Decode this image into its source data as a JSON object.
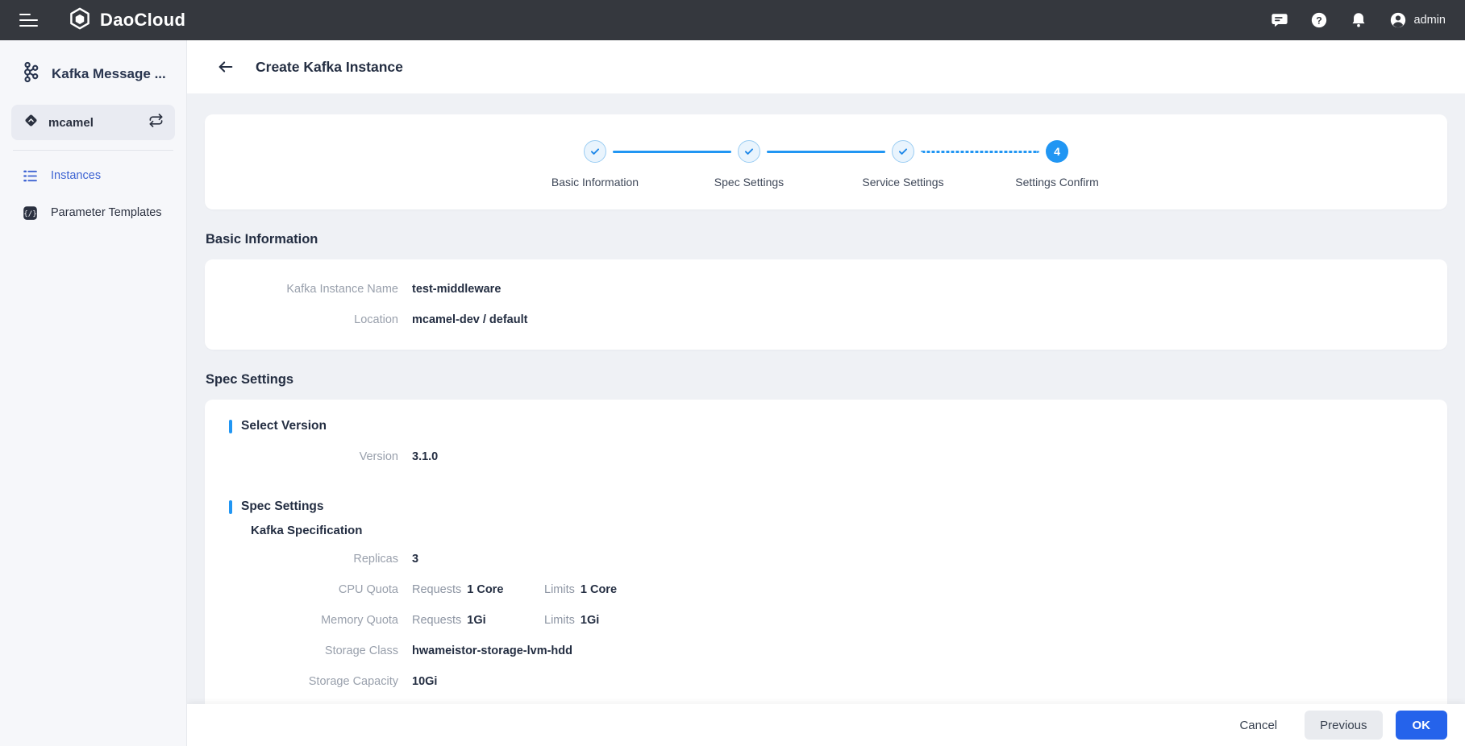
{
  "topbar": {
    "brand": "DaoCloud",
    "user": "admin",
    "icons": [
      "message-icon",
      "help-icon",
      "bell-icon",
      "avatar-icon"
    ]
  },
  "sidebar": {
    "app_title": "Kafka Message ...",
    "workspace": "mcamel",
    "items": [
      {
        "label": "Instances",
        "icon": "list-icon",
        "active": true
      },
      {
        "label": "Parameter Templates",
        "icon": "template-icon",
        "active": false
      }
    ]
  },
  "header": {
    "title": "Create Kafka Instance"
  },
  "stepper": {
    "steps": [
      {
        "label": "Basic Information",
        "state": "done"
      },
      {
        "label": "Spec Settings",
        "state": "done"
      },
      {
        "label": "Service Settings",
        "state": "done"
      },
      {
        "label": "Settings Confirm",
        "state": "current",
        "number": "4"
      }
    ]
  },
  "sections": {
    "basic": {
      "title": "Basic Information",
      "rows": [
        {
          "label": "Kafka Instance Name",
          "value": "test-middleware"
        },
        {
          "label": "Location",
          "value": "mcamel-dev / default"
        }
      ]
    },
    "spec": {
      "title": "Spec Settings",
      "select_version": {
        "title": "Select Version",
        "rows": [
          {
            "label": "Version",
            "value": "3.1.0"
          }
        ]
      },
      "spec_settings": {
        "title": "Spec Settings",
        "subtitle": "Kafka Specification",
        "rows": [
          {
            "label": "Replicas",
            "value": "3"
          },
          {
            "label": "CPU Quota",
            "pairs": [
              {
                "k": "Requests",
                "v": "1 Core"
              },
              {
                "k": "Limits",
                "v": "1 Core"
              }
            ]
          },
          {
            "label": "Memory Quota",
            "pairs": [
              {
                "k": "Requests",
                "v": "1Gi"
              },
              {
                "k": "Limits",
                "v": "1Gi"
              }
            ]
          },
          {
            "label": "Storage Class",
            "value": "hwameistor-storage-lvm-hdd"
          },
          {
            "label": "Storage Capacity",
            "value": "10Gi"
          }
        ]
      }
    }
  },
  "footer": {
    "cancel": "Cancel",
    "previous": "Previous",
    "ok": "OK"
  },
  "colors": {
    "topbar_bg": "#35383e",
    "sidebar_bg": "#f6f7fa",
    "content_bg": "#eff1f5",
    "accent_blue": "#2196f3",
    "primary_button": "#2563eb",
    "active_nav": "#3d63d2",
    "label_gray": "#99a0ac",
    "text_dark": "#242e42"
  }
}
